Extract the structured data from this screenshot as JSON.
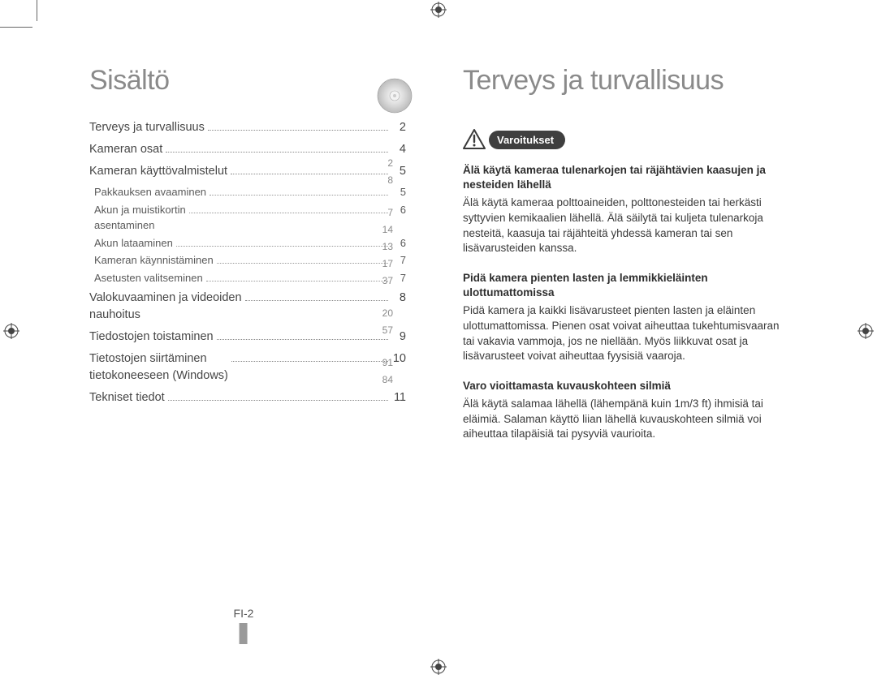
{
  "left": {
    "title": "Sisältö",
    "toc": [
      {
        "label": "Terveys ja turvallisuus",
        "page": "2"
      },
      {
        "label": "Kameran osat",
        "page": "4"
      },
      {
        "label": "Kameran käyttövalmistelut",
        "page": "5",
        "sub": [
          {
            "label": "Pakkauksen avaaminen",
            "page": "5"
          },
          {
            "label": "Akun ja muistikortin\nasentaminen",
            "page": "6"
          },
          {
            "label": "Akun lataaminen",
            "page": "6"
          },
          {
            "label": "Kameran käynnistäminen",
            "page": "7"
          },
          {
            "label": "Asetusten valitseminen",
            "page": "7"
          }
        ]
      },
      {
        "label": "Valokuvaaminen ja videoiden\nnauhoitus",
        "page": "8"
      },
      {
        "label": "Tiedostojen toistaminen",
        "page": "9"
      },
      {
        "label": "Tietostojen siirtäminen\ntietokoneeseen (Windows)",
        "page": "10"
      },
      {
        "label": "Tekniset tiedot",
        "page": "11"
      }
    ],
    "side_numbers": [
      "2",
      "8",
      "",
      "7",
      "14",
      "13",
      "17",
      "37",
      "",
      "20",
      "57",
      "",
      "91",
      "84"
    ],
    "page_number": "FI-2"
  },
  "right": {
    "title": "Terveys ja turvallisuus",
    "badge": "Varoitukset",
    "warnings": [
      {
        "title": "Älä käytä kameraa tulenarkojen tai räjähtävien kaasujen ja nesteiden lähellä",
        "body": "Älä käytä kameraa polttoaineiden, polttonesteiden tai herkästi syttyvien kemikaalien lähellä. Älä säilytä tai kuljeta tulenarkoja nesteitä, kaasuja tai räjähteitä yhdessä kameran tai sen lisävarusteiden kanssa."
      },
      {
        "title": "Pidä kamera pienten lasten ja lemmikkieläinten ulottumattomissa",
        "body": "Pidä kamera ja kaikki lisävarusteet pienten lasten ja eläinten ulottumattomissa. Pienen osat voivat aiheuttaa tukehtumisvaaran tai vakavia vammoja, jos ne niellään. Myös liikkuvat osat ja lisävarusteet voivat aiheuttaa fyysisiä vaaroja."
      },
      {
        "title": "Varo vioittamasta kuvauskohteen silmiä",
        "body": "Älä käytä salamaa lähellä (lähempänä kuin 1m/3 ft) ihmisiä tai eläimiä. Salaman käyttö liian lähellä kuvauskohteen silmiä voi aiheuttaa tilapäisiä tai pysyviä vaurioita."
      }
    ]
  }
}
